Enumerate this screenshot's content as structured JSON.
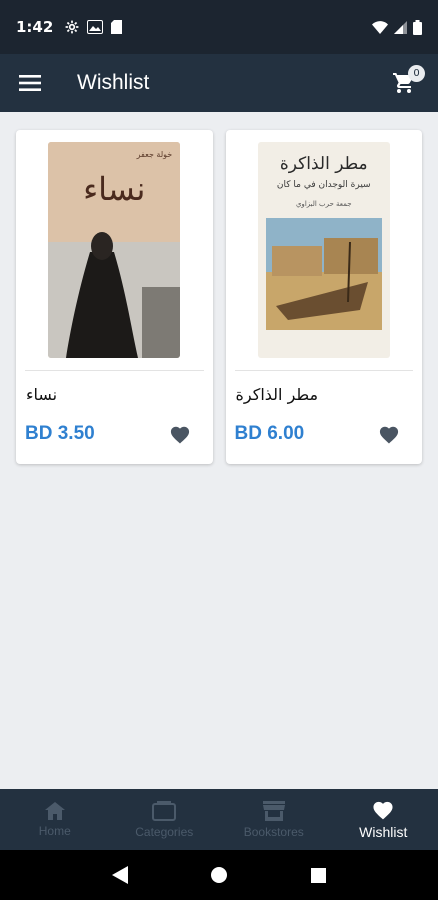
{
  "status_bar": {
    "time": "1:42"
  },
  "app_bar": {
    "title": "Wishlist",
    "cart_count": "0"
  },
  "books": [
    {
      "title": "نساء",
      "price": "BD 3.50",
      "cover_title": "نساء",
      "cover_author": "خولة جعفر"
    },
    {
      "title": "مطر الذاكرة",
      "price": "BD 6.00",
      "cover_title": "مطر الذاكرة",
      "cover_subtitle": "سيرة الوجدان في ما كان",
      "cover_author": "جمعة حرب البزاوي"
    }
  ],
  "bottom_nav": {
    "items": [
      {
        "label": "Home",
        "icon": "home-icon"
      },
      {
        "label": "Categories",
        "icon": "categories-icon"
      },
      {
        "label": "Bookstores",
        "icon": "store-icon"
      },
      {
        "label": "Wishlist",
        "icon": "heart-icon",
        "active": true
      }
    ]
  },
  "colors": {
    "app_bar": "#233140",
    "status_bar": "#1c2530",
    "price": "#2f80d0",
    "background": "#eceef1"
  }
}
